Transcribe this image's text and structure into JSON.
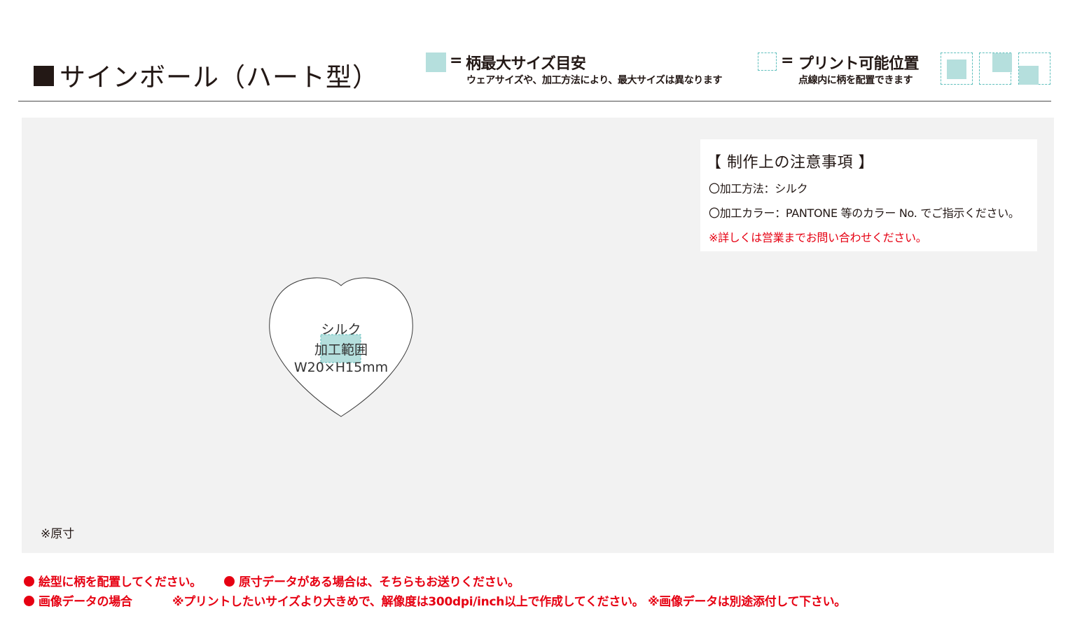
{
  "header": {
    "title": "サインボール（ハート型）",
    "legend_max": {
      "equals": "=",
      "label": "柄最大サイズ目安",
      "note": "ウェアサイズや、加工方法により、最大サイズは異なります"
    },
    "legend_print": {
      "equals": "=",
      "label": "プリント可能位置",
      "note": "点線内に柄を配置できます"
    }
  },
  "notes": {
    "title": "【 制作上の注意事項 】",
    "method": "〇加工方法：シルク",
    "color": "〇加工カラー：PANTONE 等のカラー No. でご指示ください。",
    "warning": "※詳しくは営業までお問い合わせください。"
  },
  "heart": {
    "line1": "シルク",
    "line2": "加工範囲",
    "line3": "W20×H15mm"
  },
  "scale_note": "※原寸",
  "footer": {
    "line1a": "絵型に柄を配置してください。",
    "line1b": "原寸データがある場合は、そちらもお送りください。",
    "line2a": "画像データの場合",
    "line2b": "※プリントしたいサイズより大きめで、解像度は300dpi/inch以上で作成してください。 ※画像データは別途添付して下さい。"
  },
  "colors": {
    "swatch": "#b5dfdd",
    "dashed": "#5fbfbd",
    "warning": "#e60012",
    "panel": "#f2f2f2"
  }
}
